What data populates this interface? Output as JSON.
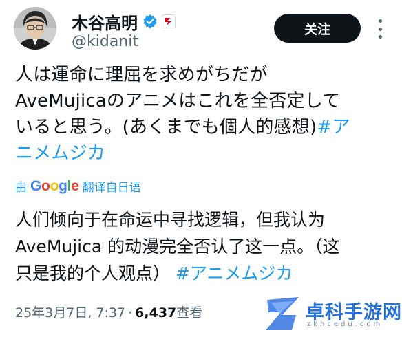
{
  "author": {
    "display_name": "木谷高明",
    "handle": "@kidanit",
    "verified_icon": "verified-check-icon",
    "affiliate_badge_icon": "bushiroad-logo-icon"
  },
  "actions": {
    "follow_label": "关注",
    "more_icon": "more-options-icon"
  },
  "tweet": {
    "lines": [
      "人は運命に理屈を求めがちだが",
      "AveMujicaのアニメはこれを全否定して",
      "いると思う。(あくまでも個人的感想)",
      "ニメムジカ"
    ],
    "hashtag_line3": "#ア",
    "hashtag_line4_prefix": ""
  },
  "translation": {
    "prefix": "由",
    "provider": "Google",
    "suffix": "翻译自日语",
    "lines": [
      "人们倾向于在命运中寻找逻辑，但我认为",
      "AveMujica 的动漫完全否认了这一点。（这",
      "只是我的个人观点）"
    ],
    "hashtag": "#アニメムジカ"
  },
  "meta": {
    "date_time": "25年3月7日, 7:37",
    "separator": "·",
    "views_count": "6,437",
    "views_label": "查看"
  },
  "watermark": {
    "title": "卓科手游网",
    "subtitle": "zkhcedu.com"
  },
  "colors": {
    "accent": "#1d9bf0",
    "text": "#0f1419",
    "secondary": "#536471",
    "button_bg": "#0f1419"
  }
}
